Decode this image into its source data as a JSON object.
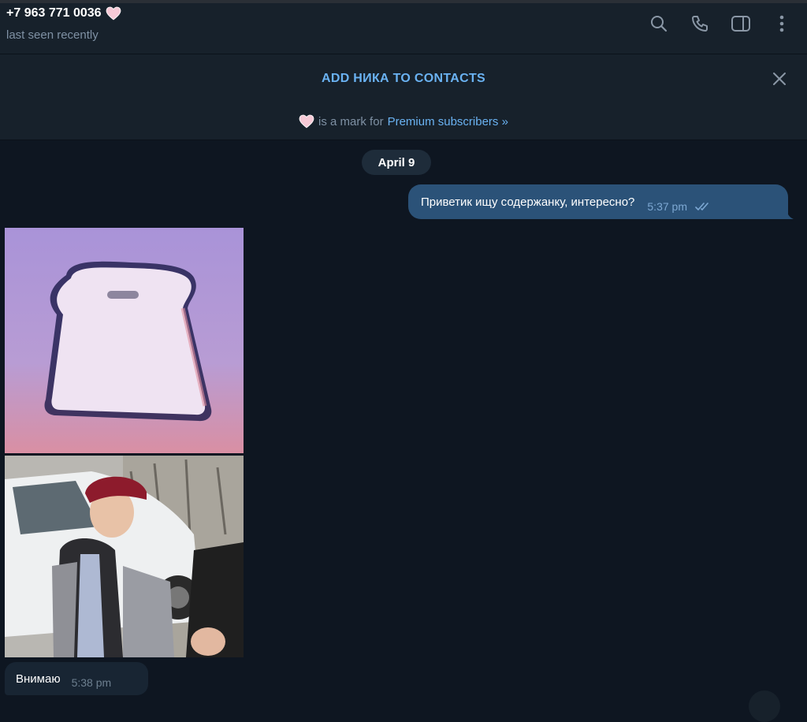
{
  "header": {
    "title": "+7 963 771 0036",
    "status": "last seen recently",
    "icons": [
      "search-icon",
      "phone-icon",
      "sidebar-icon",
      "more-icon"
    ]
  },
  "banner": {
    "add_contact": "ADD НИКА TO CONTACTS",
    "premium_text": "is a mark for",
    "premium_link": "Premium subscribers »"
  },
  "chat": {
    "date": "April 9",
    "outgoing": {
      "text": "Приветик ищу содержанку, интересно?",
      "time": "5:37 pm",
      "status": "read"
    },
    "incoming": {
      "text": "Внимаю",
      "time": "5:38 pm"
    }
  },
  "colors": {
    "background": "#0e1621",
    "header": "#17212b",
    "accent": "#6ab2f2",
    "outgoing_bubble": "#2b5278",
    "incoming_bubble": "#182533"
  }
}
